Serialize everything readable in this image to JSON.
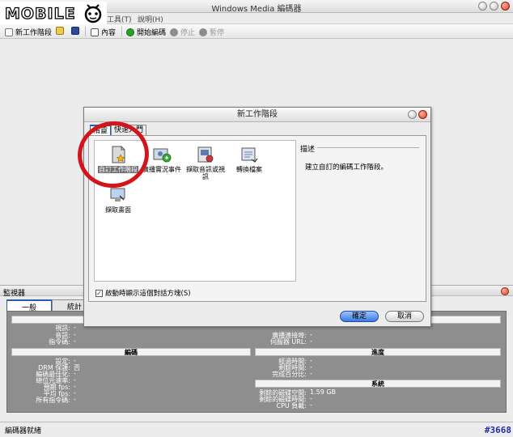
{
  "window": {
    "title": "Windows Media 編碼器"
  },
  "menu": {
    "items": [
      "工具(T)",
      "說明(H)"
    ]
  },
  "logo": {
    "text": "MOBILE"
  },
  "toolbar": {
    "new_session": "新工作階段",
    "properties": "內容",
    "start_encoding": "開始編碼",
    "stop": "停止",
    "pause": "暫停"
  },
  "monitor": {
    "title": "監視器",
    "tabs": [
      "一般",
      "統計"
    ],
    "sections": {
      "encoding": "編碼",
      "progress": "進度",
      "system": "系統"
    },
    "left_top_rows": [
      {
        "label": "視訊:",
        "value": "-"
      },
      {
        "label": "音訊:",
        "value": "-"
      },
      {
        "label": "指令碼:",
        "value": "-"
      }
    ],
    "right_top_rows": [
      {
        "label": "廣播連接埠:",
        "value": "-"
      },
      {
        "label": "伺服器 URL:",
        "value": "-"
      }
    ],
    "encoding_rows": [
      {
        "label": "設定:",
        "value": "-"
      },
      {
        "label": "DRM 保護:",
        "value": "否"
      },
      {
        "label": "編碼最佳化:",
        "value": "-"
      },
      {
        "label": "總位元速率:",
        "value": "-"
      },
      {
        "label": "預期 fps:",
        "value": "-"
      },
      {
        "label": "平均 fps:",
        "value": "-"
      },
      {
        "label": "所有指令碼:",
        "value": "-"
      }
    ],
    "progress_rows": [
      {
        "label": "經過時間:",
        "value": "-"
      },
      {
        "label": "剩餘時間:",
        "value": "-"
      },
      {
        "label": "完成百分比:",
        "value": "-"
      }
    ],
    "system_rows": [
      {
        "label": "剩餘的磁碟空間:",
        "value": "1.59 GB"
      },
      {
        "label": "剩餘的磁碟時間:",
        "value": "-"
      },
      {
        "label": "CPU 負載:",
        "value": "-"
      }
    ]
  },
  "status": {
    "text": "編碼器就緒",
    "tag": "#3668"
  },
  "dialog": {
    "title": "新工作階段",
    "tabs": [
      "精靈",
      "快速入門"
    ],
    "tiles": [
      {
        "label": "自訂工作階段"
      },
      {
        "label": "廣播實況事件"
      },
      {
        "label": "擷取音訊或視訊"
      },
      {
        "label": "轉換檔案"
      },
      {
        "label": "擷取畫面"
      }
    ],
    "description_header": "描述",
    "description_text": "建立自訂的編碼工作階段。",
    "checkbox_label": "啟動時顯示這個對話方塊(S)",
    "checkbox_checked": true,
    "ok_label": "確定",
    "cancel_label": "取消"
  },
  "colors": {
    "annotation_circle": "#d4141a",
    "selection": "#707070",
    "accent": "#2a5db0"
  }
}
